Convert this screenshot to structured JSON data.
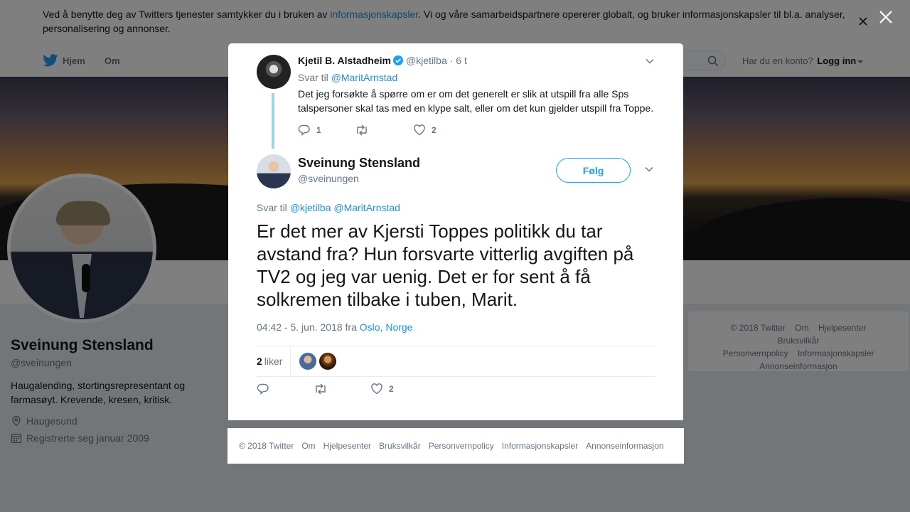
{
  "cookie_bar": {
    "text_before": "Ved å benytte deg av Twitters tjenester samtykker du i bruken av ",
    "link": "informasjonskapsler",
    "text_after": ". Vi og våre samarbeidspartnere opererer globalt, og bruker informasjonskapsler til bl.a. analyser, personalisering og annonser."
  },
  "nav": {
    "home_label": "Hjem",
    "about_label": "Om",
    "account_prompt": "Har du en konto?",
    "login_label": "Logg inn"
  },
  "profile": {
    "name": "Sveinung Stensland",
    "handle": "@sveinungen",
    "bio": "Haugalending, stortingsrepresentant og farmasøyt. Krevende, kresen, kritisk.",
    "location": "Haugesund",
    "joined": "Registrerte seg januar 2009"
  },
  "side_footer": {
    "links": [
      "© 2018 Twitter",
      "Om",
      "Hjelpesenter",
      "Bruksvilkår",
      "Personvernpolicy",
      "Informasjonskapsler",
      "Annonseinformasjon"
    ]
  },
  "parent_tweet": {
    "name": "Kjetil B. Alstadheim",
    "handle": "@kjetilba",
    "time": "· 6 t",
    "reply_prefix": "Svar til ",
    "reply_to": "@MaritArnstad",
    "text": "Det jeg forsøkte å spørre om er om det generelt er slik at utspill fra alle Sps talspersoner skal tas med en klype salt, eller om det kun gjelder utspill fra Toppe.",
    "replies": "1",
    "retweets": "",
    "likes": "2"
  },
  "main_tweet": {
    "name": "Sveinung Stensland",
    "handle": "@sveinungen",
    "follow_label": "Følg",
    "reply_prefix": "Svar til ",
    "reply_to_1": "@kjetilba",
    "reply_to_2": "@MaritArnstad",
    "text": "Er det mer av Kjersti Toppes politikk du tar avstand fra? Hun forsvarte vitterlig avgiften på TV2 og jeg var uenig. Det er for sent å få solkremen tilbake i tuben, Marit.",
    "timestamp": "04:42 - 5. jun. 2018 fra ",
    "location": "Oslo, Norge",
    "likes_count": "2",
    "likes_label": "liker",
    "action_likes": "2"
  },
  "modal_footer": {
    "links": [
      "© 2018 Twitter",
      "Om",
      "Hjelpesenter",
      "Bruksvilkår",
      "Personvernpolicy",
      "Informasjonskapsler",
      "Annonseinformasjon"
    ]
  },
  "colors": {
    "accent": "#1da1f2",
    "link": "#1b95e0",
    "thread_line": "#9fd3e6"
  }
}
